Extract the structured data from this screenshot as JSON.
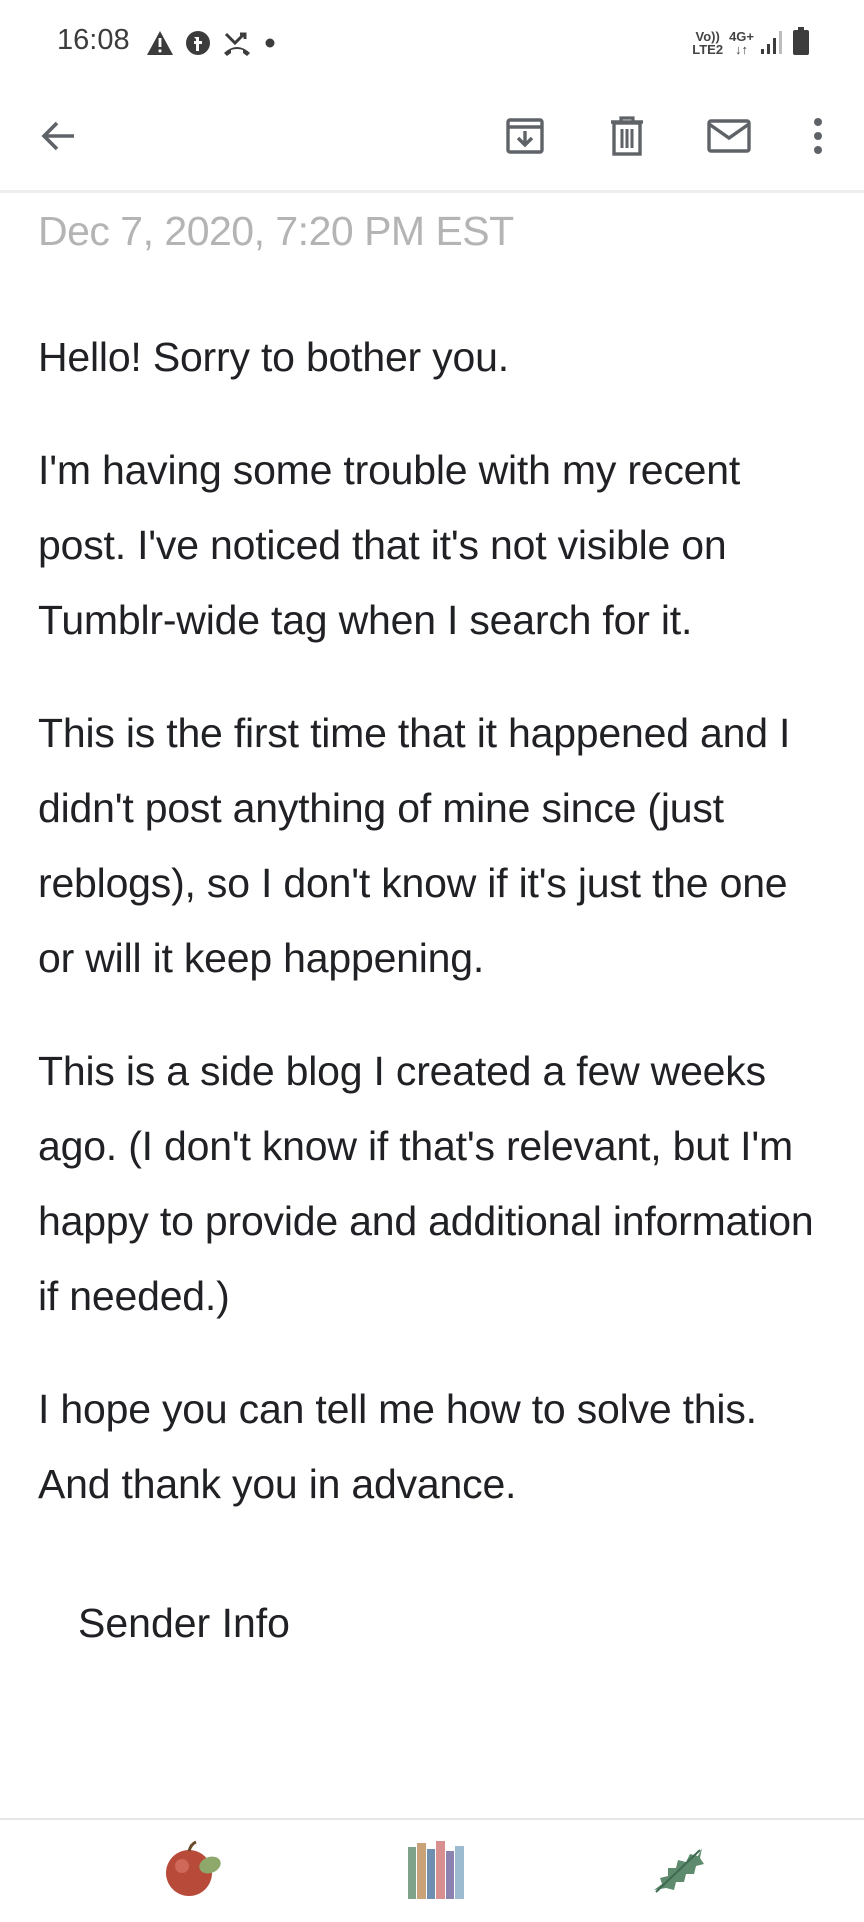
{
  "status_bar": {
    "time": "16:08",
    "volte_top": "Vo))",
    "volte_bottom": "LTE2",
    "network_top": "4G+",
    "network_bottom": "↓↑",
    "left_icons": [
      "warning-icon",
      "messenger-icon",
      "missed-call-icon",
      "dot-icon"
    ],
    "right_icons": [
      "signal-icon",
      "battery-icon"
    ]
  },
  "toolbar": {
    "back_icon": "arrow-left-icon",
    "archive_icon": "archive-icon",
    "delete_icon": "trash-icon",
    "unread_icon": "mail-icon",
    "more_icon": "more-vert-icon"
  },
  "message": {
    "date": "Dec 7, 2020, 7:20 PM EST",
    "paragraphs": [
      "Hello! Sorry to bother you.",
      "I'm having some trouble with my recent post. I've noticed that it's not visible on Tumblr-wide tag when I search for it.",
      "This is the first time that it happened and I didn't post anything of mine since (just reblogs), so I don't know if it's just the one or will it keep happening.",
      "This is a side blog I created a few weeks ago. (I don't know if that's relevant, but I'm happy to provide and additional information if needed.)",
      "I hope you can tell me how to solve this. And thank you in advance."
    ],
    "sender_info": "Sender Info"
  },
  "bottom_nav": {
    "items": [
      "apple-icon",
      "books-icon",
      "holly-leaf-icon"
    ]
  },
  "colors": {
    "text": "#202124",
    "date": "#b4b4b4",
    "icon": "#5f6368",
    "divider": "#eeeeee"
  }
}
